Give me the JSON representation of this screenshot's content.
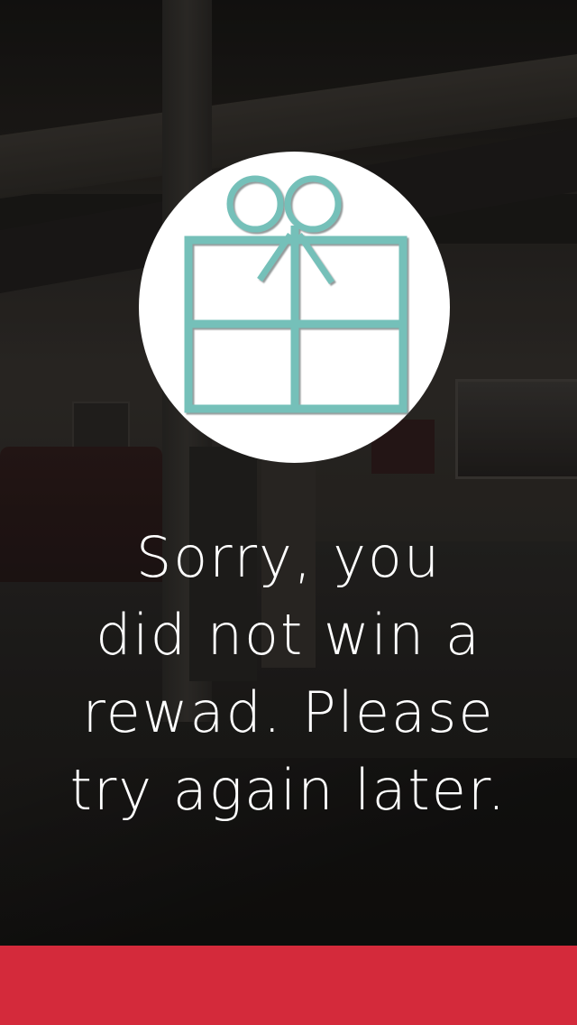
{
  "message": {
    "line1": "Sorry, you",
    "line2": "did not win a",
    "line3": "rewad. Please",
    "line4": "try again later."
  },
  "icons": {
    "main": "gift-icon"
  },
  "colors": {
    "gift_outline": "#74c0b9",
    "circle_fill": "#ffffff",
    "bottom_bar": "#d42a3b",
    "text": "#ffffff"
  }
}
